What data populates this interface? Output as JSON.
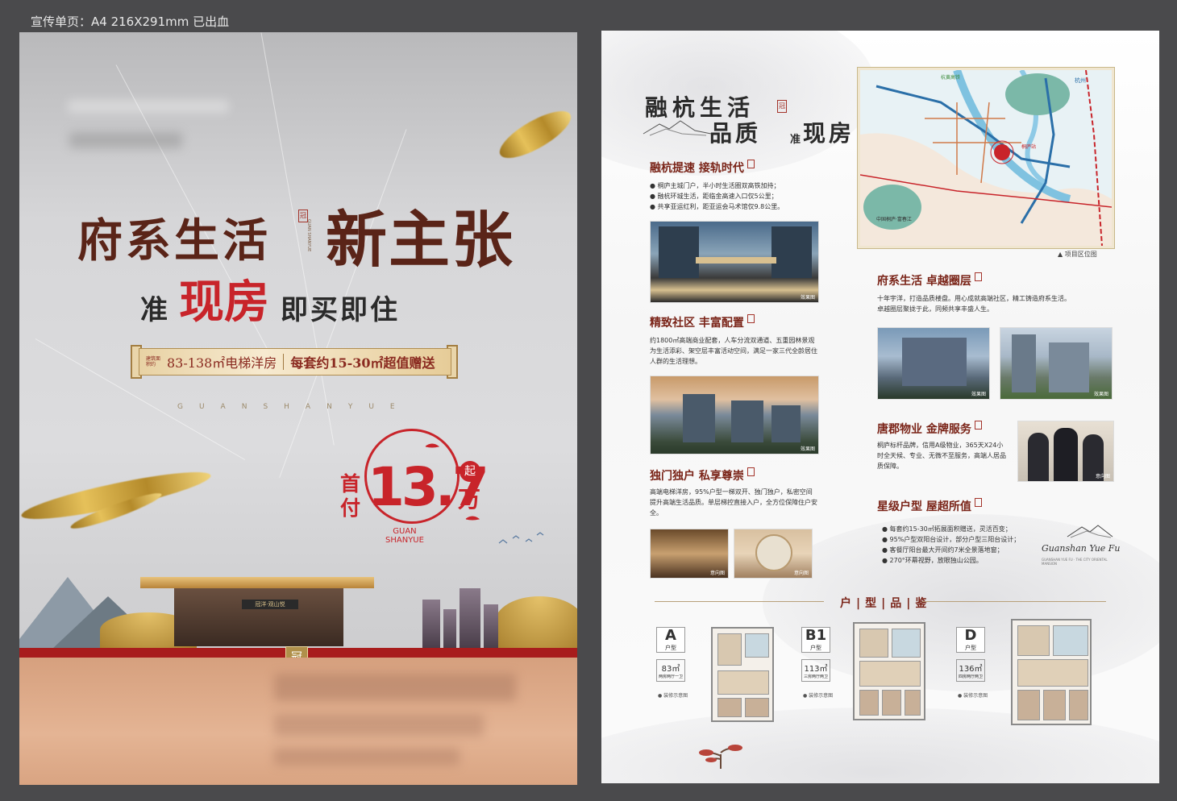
{
  "spec_label": "宣传单页：A4 216X291mm 已出血",
  "front": {
    "headline_1": "府系生活",
    "headline_2": "新主张",
    "seal_char": "冠",
    "vertical_en": "GUAN SHANYUE",
    "subtitle_pre": "准",
    "subtitle_main": "现房",
    "subtitle_post": "即买即住",
    "ribbon": {
      "tiny": "建筑面积约",
      "area": "83-138㎡电梯洋房",
      "gift": "每套约15-30㎡超值赠送"
    },
    "brand_en": "GUANSHANYUE",
    "price": {
      "prefix": "首付",
      "value": "13.7",
      "qi": "起",
      "unit": "万",
      "stamp_en_1": "GUAN",
      "stamp_en_2": "SHANYUE"
    },
    "gate_sign": "冠洋·观山悦",
    "logo_char": "冠"
  },
  "back": {
    "title_top": "融杭生活",
    "title_bottom_a": "品质",
    "title_small": "准",
    "title_bottom_b": "现房",
    "map_caption": "▲ 项目区位图",
    "map_labels": {
      "hangzhou": "杭州",
      "station": "桐庐站",
      "hsr": "杭黄高铁",
      "park": "中国桐庐·富春江"
    },
    "sections": {
      "location": {
        "title": "融杭提速 接轨时代",
        "lines": [
          "● 桐庐主城门户，半小时生活圈双高铁加持；",
          "● 融杭环城生活，距临金高速入口仅5公里；",
          "● 共享亚运红利，距亚运会马术馆仅9.8公里。"
        ]
      },
      "community": {
        "title": "精致社区 丰富配置",
        "body": "约1800㎡高端商业配套，人车分流双通道、五重园林景观为生活添彩、架空层丰富活动空间，满足一家三代全龄居住人群的生活理想。"
      },
      "private": {
        "title": "独门独户 私享尊崇",
        "body": "高端电梯洋房，95%户型一梯双开、独门独户，私密空间提升高端生活品质。单层梯控直接入户，全方位保障住户安全。"
      },
      "circle": {
        "title": "府系生活 卓越圈层",
        "body": "十年宇洋，打造品质楼盘。用心成就高端社区，精工铸造府系生活。卓越圈层聚拢于此，同频共享丰盛人生。"
      },
      "service": {
        "title": "唐郡物业 金牌服务",
        "body": "桐庐标杆品牌，信用A级物业，365天X24小时全天候、专业、无微不至服务，高端人居品质保障。"
      },
      "value": {
        "title": "星级户型 屋超所值",
        "lines": [
          "● 每套约15-30㎡拓展面积赠送，灵活百变；",
          "● 95%户型双阳台设计，部分户型三阳台设计；",
          "● 客餐厅阳台最大开间约7米全景落地窗；",
          "● 270°环幕视野，放眼独山公园。"
        ]
      }
    },
    "photo_caption": "效果图",
    "photo_caption_2": "意向图",
    "brand_name": "Guanshan Yue Fu",
    "brand_tag": "GUANSHAN YUE FU · THE CITY ORIENTAL MANSION",
    "floorplan_title": "户|型|品|鉴",
    "plans": [
      {
        "code": "A",
        "type": "户型",
        "area": "83㎡",
        "desc": "两房两厅一卫",
        "note": "● 装修示意图"
      },
      {
        "code": "B1",
        "type": "户型",
        "area": "113㎡",
        "desc": "三房两厅两卫",
        "note": "● 装修示意图"
      },
      {
        "code": "D",
        "type": "户型",
        "area": "136㎡",
        "desc": "四房两厅两卫",
        "note": "● 装修示意图"
      }
    ]
  }
}
